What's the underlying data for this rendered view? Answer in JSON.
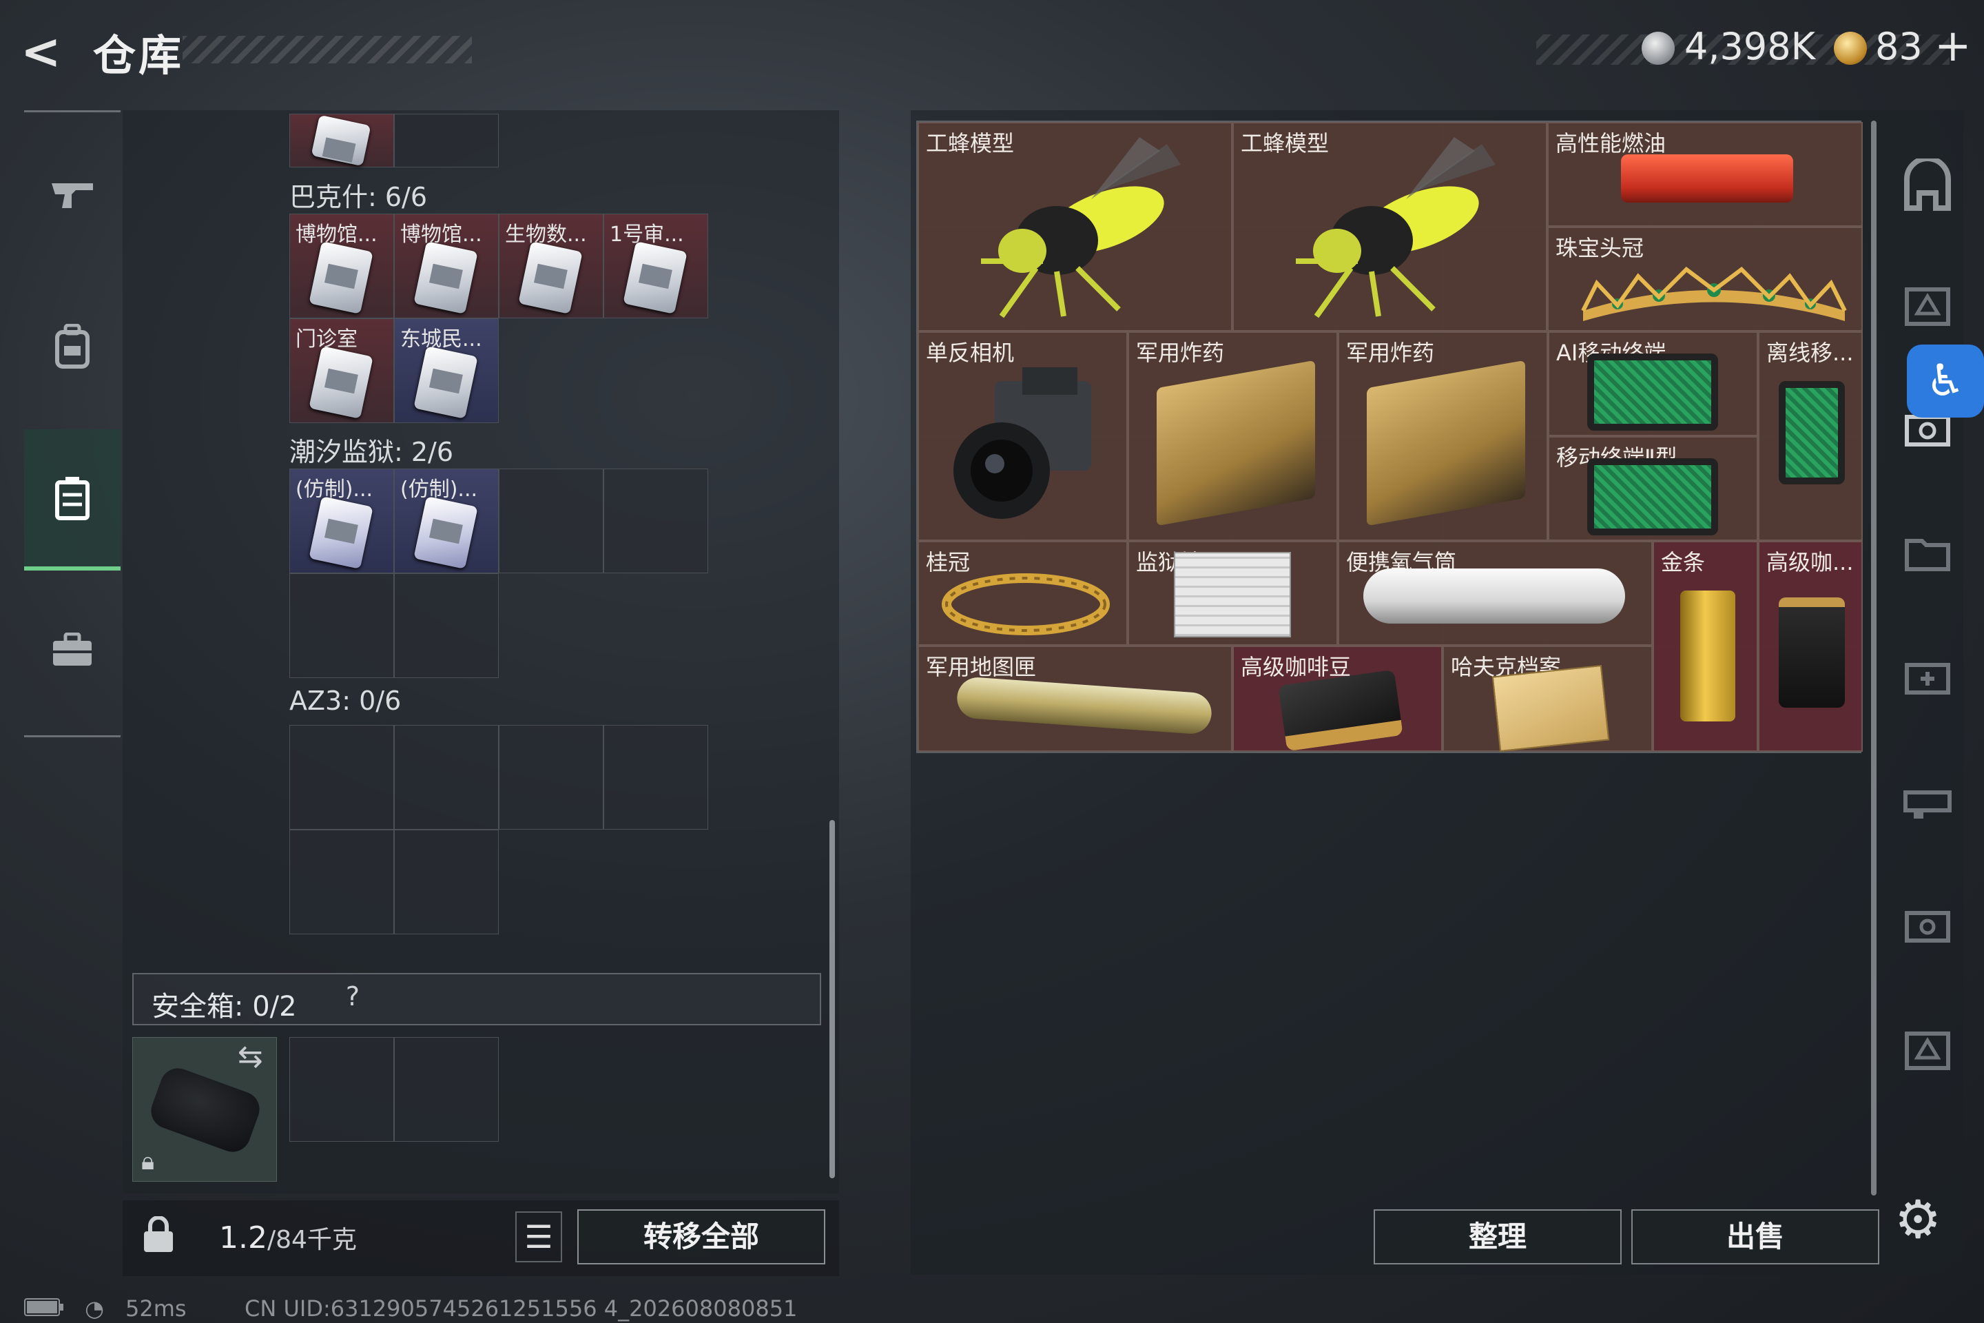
{
  "header": {
    "title": "仓库",
    "back_icon": "arrow-left-icon",
    "currency1": "4,398K",
    "currency2": "83",
    "plus": "+"
  },
  "left_nav": {
    "items": [
      {
        "name": "weapon",
        "icon": "pistol-icon"
      },
      {
        "name": "backpack",
        "icon": "backpack-icon"
      },
      {
        "name": "container",
        "icon": "container-icon",
        "active": true
      },
      {
        "name": "case",
        "icon": "briefcase-icon"
      }
    ]
  },
  "containers": {
    "bakesh": {
      "label": "巴克什: 6/6",
      "slots": [
        "博物馆...",
        "博物馆...",
        "生物数...",
        "1号审...",
        "门诊室",
        "东城民..."
      ]
    },
    "tidal": {
      "label": "潮汐监狱: 2/6",
      "slots": [
        "(仿制)...",
        "(仿制)..."
      ]
    },
    "az3": {
      "label": "AZ3: 0/6"
    }
  },
  "safe_box": {
    "label": "安全箱: 0/2",
    "help": "?"
  },
  "bottom_left": {
    "weight_current": "1.2",
    "weight_max": "/84千克",
    "transfer_all": "转移全部"
  },
  "status": {
    "ping": "52ms",
    "uid": "CN UID:6312905745261251556 4_202608080851"
  },
  "stash_items": [
    {
      "name": "工蜂模型"
    },
    {
      "name": "工蜂模型"
    },
    {
      "name": "高性能燃油"
    },
    {
      "name": "珠宝头冠"
    },
    {
      "name": "单反相机"
    },
    {
      "name": "军用炸药"
    },
    {
      "name": "军用炸药"
    },
    {
      "name": "AI移动终端"
    },
    {
      "name": "离线移..."
    },
    {
      "name": "移动终端Ⅱ型"
    },
    {
      "name": "桂冠"
    },
    {
      "name": "监狱地图1"
    },
    {
      "name": "便携氧气筒"
    },
    {
      "name": "金条"
    },
    {
      "name": "高级咖..."
    },
    {
      "name": "军用地图匣"
    },
    {
      "name": "高级咖啡豆"
    },
    {
      "name": "哈夫克档案"
    }
  ],
  "buttons": {
    "sort": "整理",
    "sell": "出售"
  }
}
